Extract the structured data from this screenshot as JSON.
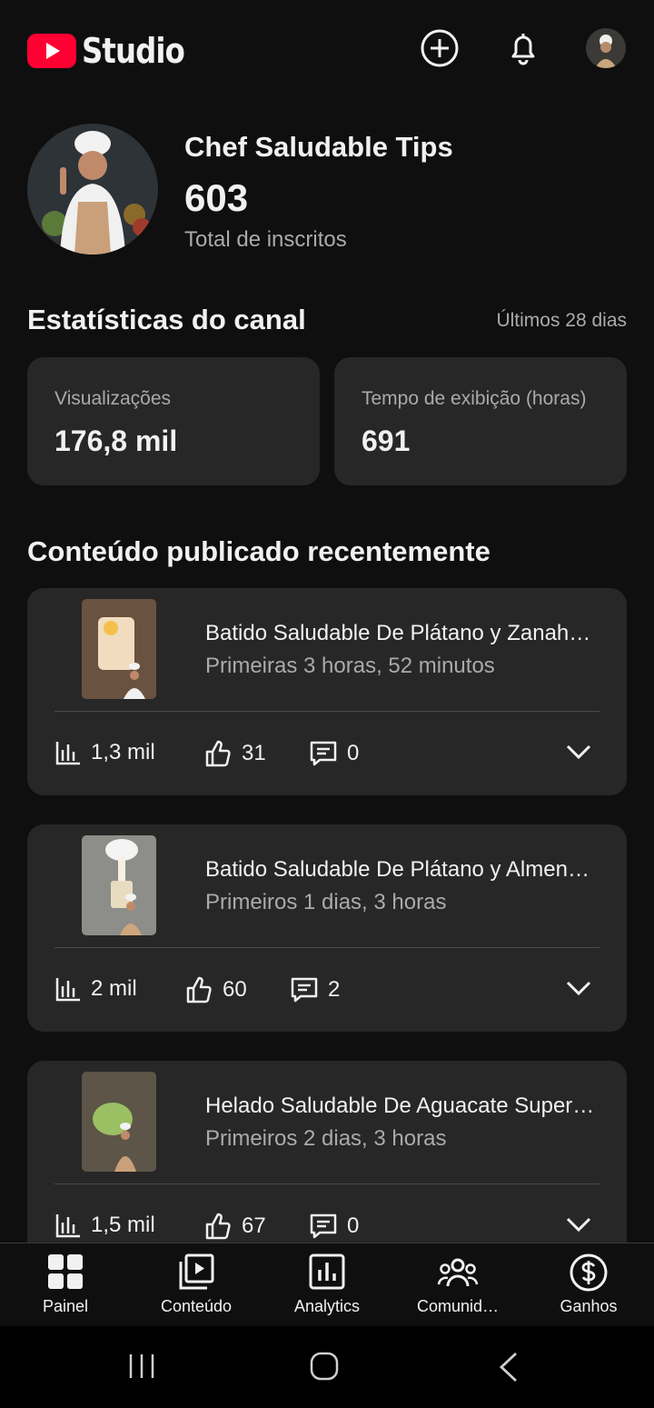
{
  "header": {
    "logo_text": "Studio",
    "icons": [
      "create-icon",
      "notifications-icon",
      "account-avatar"
    ]
  },
  "channel": {
    "name": "Chef Saludable Tips",
    "subscribers": "603",
    "subscribers_label": "Total de inscritos"
  },
  "stats": {
    "title": "Estatísticas do canal",
    "period": "Últimos 28 dias",
    "cards": [
      {
        "label": "Visualizações",
        "value": "176,8 mil"
      },
      {
        "label": "Tempo de exibição (horas)",
        "value": "691"
      }
    ]
  },
  "recent": {
    "title": "Conteúdo publicado recentemente",
    "videos": [
      {
        "title": "Batido Saludable De Plátano y Zanahoria",
        "subtitle": "Primeiras 3 horas, 52 minutos",
        "views": "1,3 mil",
        "likes": "31",
        "comments": "0"
      },
      {
        "title": "Batido Saludable De Plátano y Almendras",
        "subtitle": "Primeiros 1 dias, 3 horas",
        "views": "2 mil",
        "likes": "60",
        "comments": "2"
      },
      {
        "title": "Helado Saludable De Aguacate Super Cremoso",
        "subtitle": "Primeiros 2 dias, 3 horas",
        "views": "1,5 mil",
        "likes": "67",
        "comments": "0"
      }
    ]
  },
  "nav": {
    "items": [
      {
        "label": "Painel",
        "icon": "dashboard-icon"
      },
      {
        "label": "Conteúdo",
        "icon": "content-icon"
      },
      {
        "label": "Analytics",
        "icon": "analytics-icon"
      },
      {
        "label": "Comunid…",
        "icon": "community-icon"
      },
      {
        "label": "Ganhos",
        "icon": "earnings-icon"
      }
    ]
  },
  "colors": {
    "background": "#0f0f0f",
    "card": "#272727",
    "brand_red": "#ff0033",
    "secondary_text": "#aaaaaa"
  }
}
